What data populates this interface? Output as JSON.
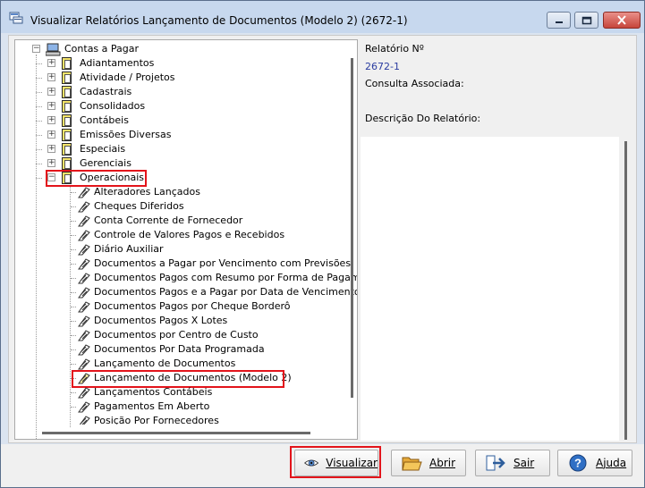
{
  "window": {
    "title": "Visualizar Relatórios Lançamento de Documentos (Modelo 2) (2672-1)"
  },
  "tree": {
    "root": {
      "label": "Contas a Pagar",
      "icon": "computer-icon",
      "expanded": true
    },
    "groups": [
      {
        "label": "Adiantamentos",
        "expanded": false
      },
      {
        "label": "Atividade / Projetos",
        "expanded": false
      },
      {
        "label": "Cadastrais",
        "expanded": false
      },
      {
        "label": "Consolidados",
        "expanded": false
      },
      {
        "label": "Contábeis",
        "expanded": false
      },
      {
        "label": "Emissões Diversas",
        "expanded": false
      },
      {
        "label": "Especiais",
        "expanded": false
      },
      {
        "label": "Gerenciais",
        "expanded": false
      },
      {
        "label": "Operacionais",
        "expanded": true,
        "highlighted": true
      }
    ],
    "reports": [
      {
        "label": "Alteradores Lançados"
      },
      {
        "label": "Cheques Diferidos"
      },
      {
        "label": "Conta Corrente de Fornecedor"
      },
      {
        "label": "Controle de Valores Pagos e Recebidos"
      },
      {
        "label": "Diário Auxiliar"
      },
      {
        "label": "Documentos a Pagar por Vencimento com Previsões"
      },
      {
        "label": "Documentos Pagos com Resumo por Forma de Pagam"
      },
      {
        "label": "Documentos Pagos e a Pagar por Data de Vencimento"
      },
      {
        "label": "Documentos Pagos por Cheque Borderô"
      },
      {
        "label": "Documentos Pagos X Lotes"
      },
      {
        "label": "Documentos por Centro de Custo"
      },
      {
        "label": "Documentos Por Data Programada"
      },
      {
        "label": "Lançamento de Documentos"
      },
      {
        "label": "Lançamento de Documentos (Modelo 2)",
        "selected": true,
        "highlighted": true
      },
      {
        "label": "Lançamentos Contábeis"
      },
      {
        "label": "Pagamentos Em Aberto"
      },
      {
        "label": "Posição Por Fornecedores"
      }
    ]
  },
  "info": {
    "relatorio_label": "Relatório Nº",
    "relatorio_value": "2672-1",
    "consulta_label": "Consulta Associada:",
    "descricao_label": "Descrição Do Relatório:"
  },
  "buttons": {
    "visualizar": "Visualizar",
    "abrir": "Abrir",
    "sair": "Sair",
    "ajuda": "Ajuda"
  },
  "colors": {
    "highlight": "#e3141b",
    "value_text": "#2a3ca0",
    "folder": "#f4e36a"
  }
}
